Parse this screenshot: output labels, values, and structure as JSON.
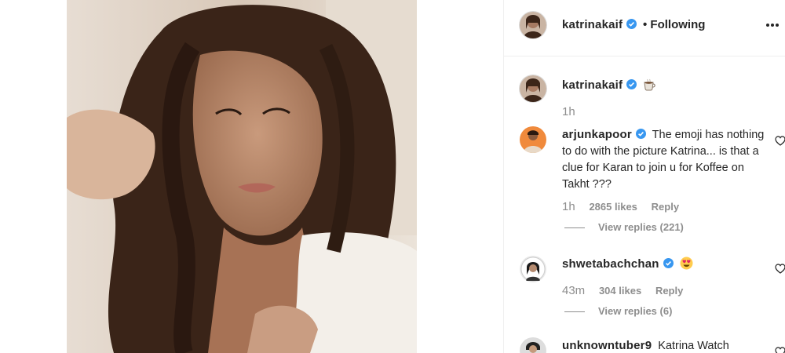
{
  "header": {
    "username": "katrinakaif",
    "following_label": "• Following"
  },
  "caption": {
    "username": "katrinakaif",
    "emoji": "coffee-emoji",
    "time": "1h"
  },
  "comments": [
    {
      "username": "arjunkapoor",
      "text": "The emoji has nothing to do with the picture Katrina... is that a clue for Karan to join u for Koffee on Takht ???",
      "time": "1h",
      "likes": "2865 likes",
      "reply_label": "Reply",
      "view_replies": "View replies (221)"
    },
    {
      "username": "shwetabachchan",
      "emoji": "heart-eyes-emoji",
      "time": "43m",
      "likes": "304 likes",
      "reply_label": "Reply",
      "view_replies": "View replies (6)"
    },
    {
      "username": "unknowntuber9",
      "text": "Katrina Watch"
    }
  ],
  "colors": {
    "verified": "#3897f0",
    "text": "#262626",
    "secondary": "#8e8e8e"
  }
}
